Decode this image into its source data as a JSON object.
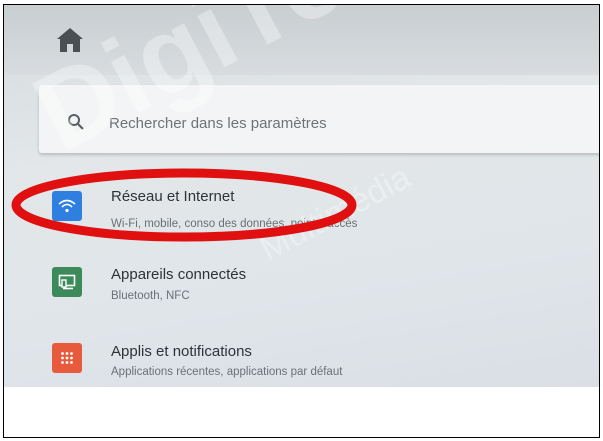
{
  "search": {
    "placeholder": "Rechercher dans les paramètres"
  },
  "settings": [
    {
      "title": "Réseau et Internet",
      "subtitle": "Wi-Fi, mobile, conso des données, point d'accès",
      "icon": "wifi-icon",
      "color": "#2f7fe0"
    },
    {
      "title": "Appareils connectés",
      "subtitle": "Bluetooth, NFC",
      "icon": "connected-devices-icon",
      "color": "#3c8a5a"
    },
    {
      "title": "Applis et notifications",
      "subtitle": "Applications récentes, applications par défaut",
      "icon": "apps-grid-icon",
      "color": "#e85a3c"
    }
  ],
  "watermark": {
    "main": "DigiTech -",
    "sub": "Multimédia"
  },
  "highlight_color": "#e01010"
}
